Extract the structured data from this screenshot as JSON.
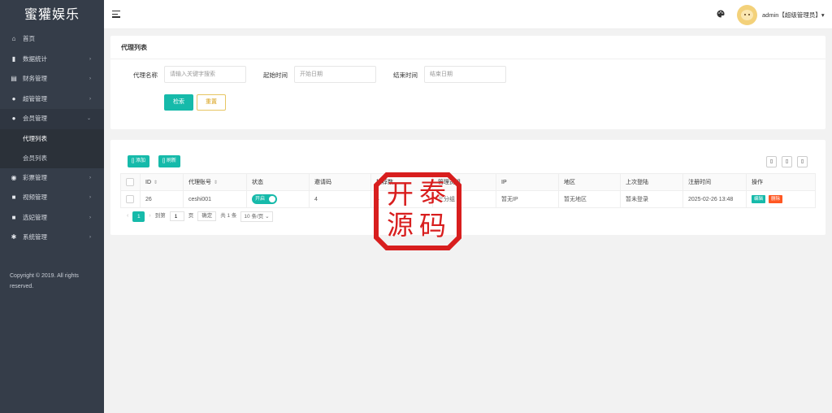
{
  "brand": {
    "title": "蜜獾娱乐"
  },
  "sidebar": {
    "items": [
      {
        "label": "首页",
        "icon": "home-icon",
        "glyph": "⌂",
        "arrow": ""
      },
      {
        "label": "数据统计",
        "icon": "bar-chart-icon",
        "glyph": "▮",
        "arrow": "›"
      },
      {
        "label": "财务管理",
        "icon": "bank-icon",
        "glyph": "▤",
        "arrow": "›"
      },
      {
        "label": "超管管理",
        "icon": "user-icon",
        "glyph": "●",
        "arrow": "›"
      },
      {
        "label": "会员管理",
        "icon": "users-icon",
        "glyph": "●",
        "arrow": "⌄"
      }
    ],
    "subitems": [
      {
        "label": "代理列表"
      },
      {
        "label": "会员列表"
      }
    ],
    "items2": [
      {
        "label": "彩票管理",
        "icon": "gamepad-icon",
        "glyph": "◉",
        "arrow": "›"
      },
      {
        "label": "视频管理",
        "icon": "video-icon",
        "glyph": "■",
        "arrow": "›"
      },
      {
        "label": "选妃管理",
        "icon": "card-icon",
        "glyph": "■",
        "arrow": "›"
      },
      {
        "label": "系统管理",
        "icon": "gear-icon",
        "glyph": "✱",
        "arrow": "›"
      }
    ],
    "copyright": "Copyright © 2019. All rights reserved."
  },
  "header": {
    "user": "admin【超级管理员】▾"
  },
  "search": {
    "title": "代理列表",
    "name_label": "代理名称",
    "name_placeholder": "请输入关键字搜索",
    "start_label": "起始时间",
    "start_placeholder": "开始日期",
    "end_label": "结束时间",
    "end_placeholder": "结束日期",
    "search_btn": "检索",
    "reset_btn": "重置"
  },
  "toolbar": {
    "add": "[] 添加",
    "refresh": "[] 刷新",
    "tool_glyph": "▯"
  },
  "table": {
    "headers": [
      "ID",
      "代理账号",
      "状态",
      "邀请码",
      "推荐数",
      "管理员组",
      "IP",
      "地区",
      "上次登陆",
      "注册时间",
      "操作"
    ],
    "sort_glyph": "⇕",
    "row": {
      "id": "26",
      "account": "ceshi001",
      "status": "开启",
      "invite": "4",
      "recommend": "4",
      "group": "三分组",
      "ip": "暂无IP",
      "region": "暂无地区",
      "last_login": "暂未登录",
      "reg_time": "2025-02-26 13:48",
      "edit": "编辑",
      "delete": "删除"
    }
  },
  "pager": {
    "prev": "‹",
    "page": "1",
    "next": "›",
    "goto": "到第",
    "input": "1",
    "unit": "页",
    "confirm": "确定",
    "total": "共 1 条",
    "per_page": "10 条/页 ⌄"
  },
  "watermark": {
    "chars": [
      "开",
      "泰",
      "源",
      "码"
    ]
  },
  "colors": {
    "accent": "#16baaa",
    "sidebar": "#353d49",
    "danger": "#ff5722",
    "seal": "#d81e1e"
  }
}
